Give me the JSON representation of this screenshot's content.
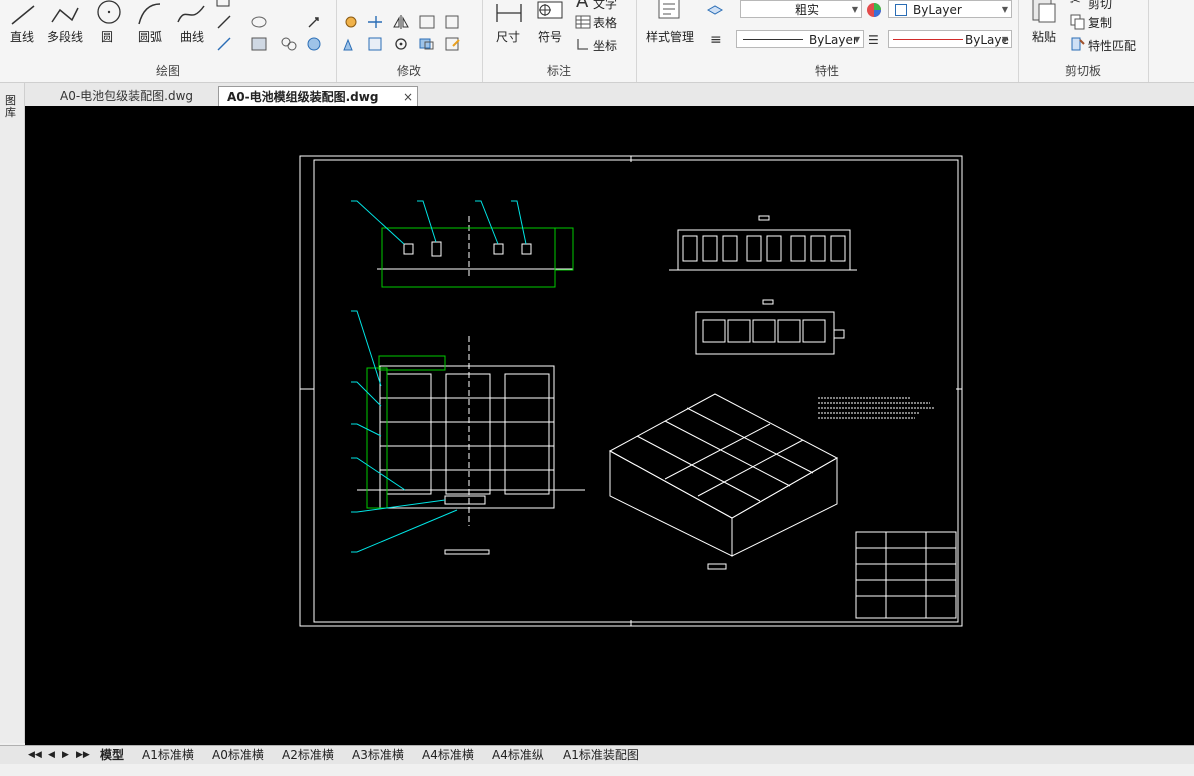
{
  "ribbon": {
    "draw": {
      "label": "绘图",
      "tools": [
        "直线",
        "多段线",
        "圆",
        "圆弧",
        "曲线"
      ]
    },
    "modify": {
      "label": "修改"
    },
    "annotate": {
      "label": "标注",
      "dimension": "尺寸",
      "symbol": "符号",
      "text": "文字",
      "table": "表格",
      "coordinate": "坐标"
    },
    "properties": {
      "label": "特性",
      "style_manager": "样式管理",
      "layer_value": "粗实",
      "color_value": "ByLayer",
      "linetype_value": "ByLayer",
      "lineweight_value": "ByLaye"
    },
    "clipboard": {
      "label": "剪切板",
      "paste": "粘贴",
      "cut": "剪切",
      "copy": "复制",
      "match_props": "特性匹配"
    }
  },
  "doc_tabs": [
    {
      "label": "A0-电池包级装配图.dwg"
    },
    {
      "label": "A0-电池模组级装配图.dwg"
    }
  ],
  "tab_close_glyph": "×",
  "left_palette": "图库",
  "layout_tabs": [
    "模型",
    "A1标准横",
    "A0标准横",
    "A2标准横",
    "A3标准横",
    "A4标准横",
    "A4标准纵",
    "A1标准装配图"
  ],
  "colors": {
    "canvas": "#000000",
    "drawing_lines": "#ffffff",
    "leader": "#00e5e5",
    "highlight": "#00cc00",
    "linetype_red": "#d22b2b"
  }
}
